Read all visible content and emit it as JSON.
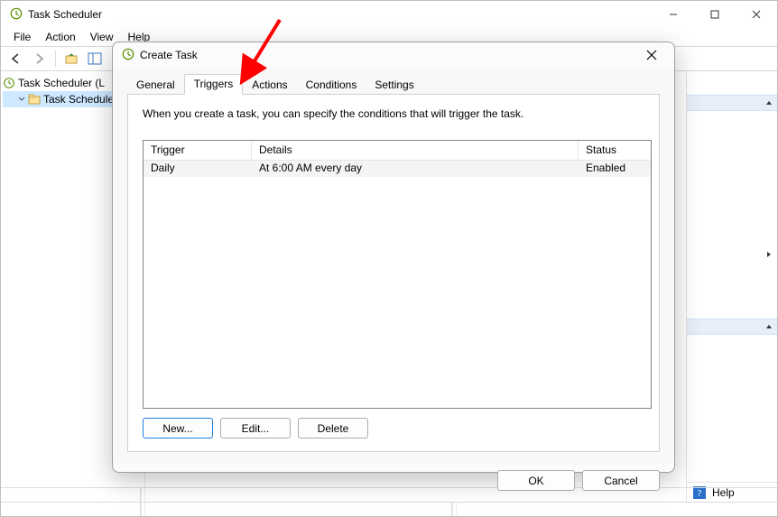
{
  "window": {
    "title": "Task Scheduler",
    "menu": [
      "File",
      "Action",
      "View",
      "Help"
    ],
    "tree": {
      "root": "Task Scheduler (L",
      "child": "Task Schedule"
    },
    "right_pane": {
      "help_label": "Help"
    }
  },
  "dialog": {
    "title": "Create Task",
    "tabs": [
      "General",
      "Triggers",
      "Actions",
      "Conditions",
      "Settings"
    ],
    "active_tab": "Triggers",
    "description": "When you create a task, you can specify the conditions that will trigger the task.",
    "table": {
      "headers": {
        "trigger": "Trigger",
        "details": "Details",
        "status": "Status"
      },
      "rows": [
        {
          "trigger": "Daily",
          "details": "At 6:00 AM every day",
          "status": "Enabled"
        }
      ]
    },
    "buttons": {
      "new": "New...",
      "edit": "Edit...",
      "delete": "Delete"
    },
    "footer": {
      "ok": "OK",
      "cancel": "Cancel"
    }
  }
}
